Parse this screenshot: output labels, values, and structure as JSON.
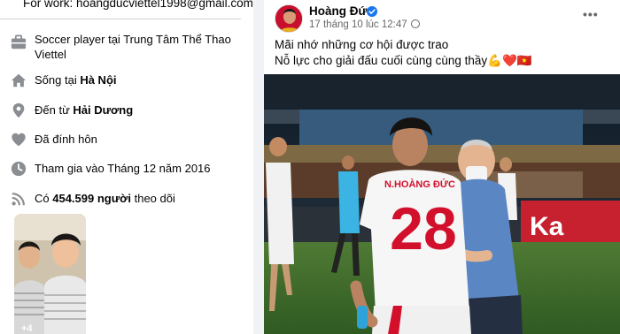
{
  "intro": {
    "email_line": "For work: hoangducviettel1998@gmail.com",
    "work": {
      "icon": "briefcase-icon",
      "prefix": "Soccer player tại ",
      "value": "Trung Tâm Thể Thao Viettel"
    },
    "lives": {
      "icon": "home-icon",
      "prefix": "Sống tại ",
      "value": "Hà Nội"
    },
    "from": {
      "icon": "location-pin-icon",
      "prefix": "Đến từ ",
      "value": "Hải Dương"
    },
    "relationship": {
      "icon": "heart-icon",
      "text": "Đã đính hôn"
    },
    "joined": {
      "icon": "clock-icon",
      "text": "Tham gia vào Tháng 12 năm 2016"
    },
    "followers": {
      "icon": "rss-icon",
      "prefix": "Có ",
      "count": "454.599 người",
      "suffix": " theo dõi"
    },
    "photo_more": "+4"
  },
  "post": {
    "author": "Hoàng Đức",
    "timestamp": "17 tháng 10 lúc 12:47",
    "more_label": "•••",
    "caption_line1": "Mãi nhớ những cơ hội được trao",
    "caption_line2": "Nỗ lực cho giải đấu cuối cùng cùng thầy💪❤️🇻🇳",
    "image": {
      "jersey_name": "N.HOÀNG ĐỨC",
      "jersey_number": "28",
      "banner_text": "Ka"
    }
  },
  "colors": {
    "accent": "#1877f2",
    "jersey_red": "#d3102c",
    "pitch": "#3e6b2c",
    "card": "#ffffff",
    "page_bg": "#f0f2f5"
  }
}
